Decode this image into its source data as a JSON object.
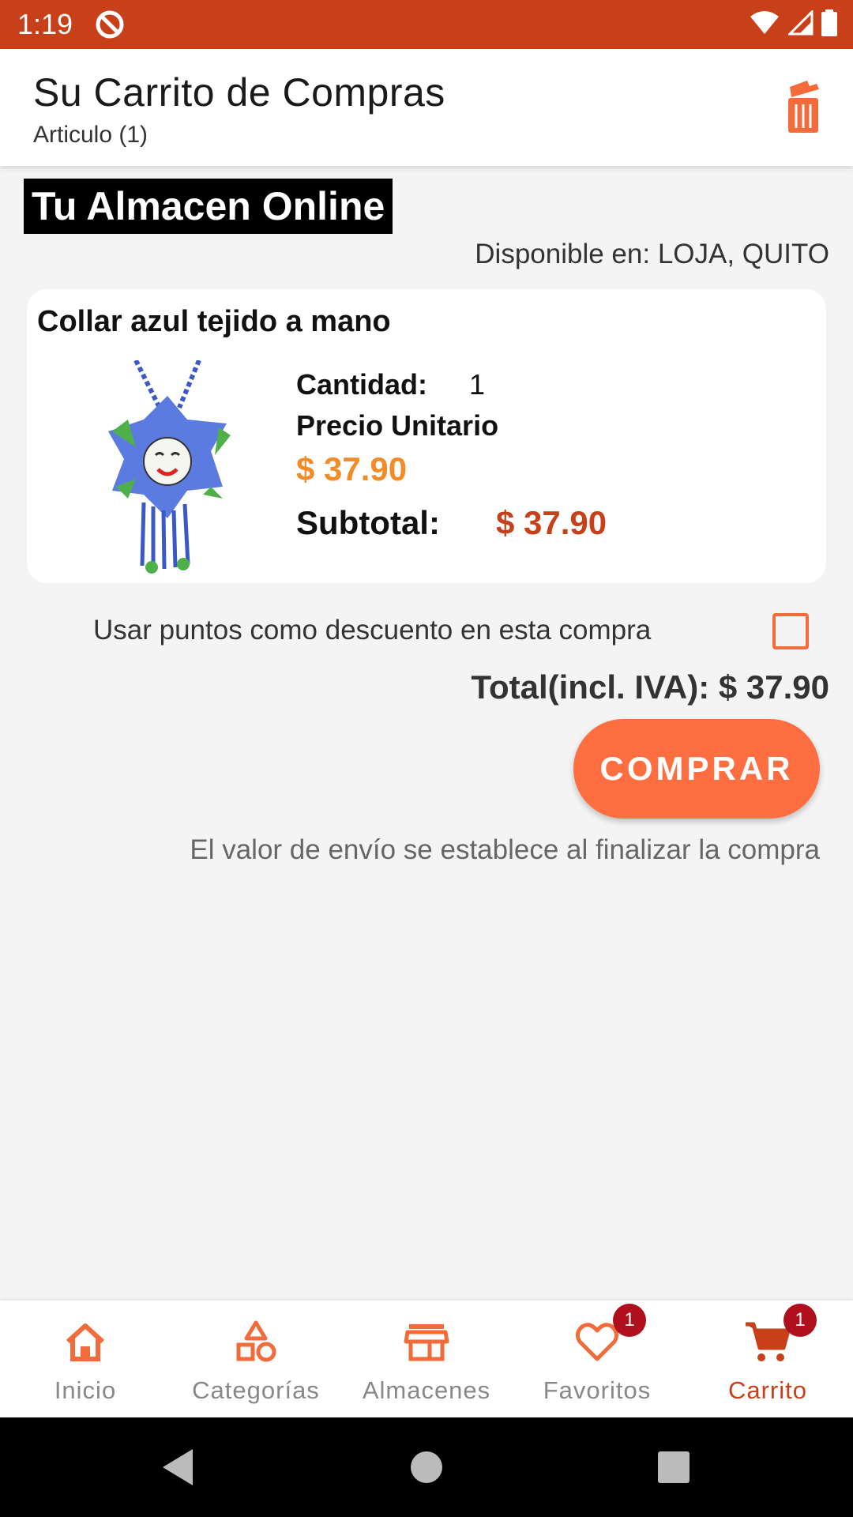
{
  "status_bar": {
    "time": "1:19"
  },
  "header": {
    "title": "Su Carrito de Compras",
    "subtitle": "Articulo (1)"
  },
  "store": {
    "name": "Tu Almacen Online",
    "availability": "Disponible en: LOJA, QUITO"
  },
  "cart_item": {
    "name": "Collar azul tejido a mano",
    "quantity_label": "Cantidad:",
    "quantity": "1",
    "unit_price_label": "Precio Unitario",
    "unit_price": "$ 37.90",
    "subtotal_label": "Subtotal:",
    "subtotal": "$ 37.90"
  },
  "points": {
    "label": "Usar puntos como descuento en esta compra",
    "checked": false
  },
  "total": "Total(incl. IVA): $ 37.90",
  "buy_button": "COMPRAR",
  "shipping_note": "El valor de envío se establece al finalizar la compra",
  "bottom_nav": {
    "items": [
      {
        "label": "Inicio",
        "icon": "home-icon"
      },
      {
        "label": "Categorías",
        "icon": "categories-icon"
      },
      {
        "label": "Almacenes",
        "icon": "store-icon"
      },
      {
        "label": "Favoritos",
        "icon": "heart-icon",
        "badge": "1"
      },
      {
        "label": "Carrito",
        "icon": "cart-icon",
        "badge": "1",
        "active": true
      }
    ]
  },
  "colors": {
    "primary": "#c8401a",
    "accent": "#ff6e40",
    "price_orange": "#f28c28",
    "badge": "#b0101e"
  }
}
